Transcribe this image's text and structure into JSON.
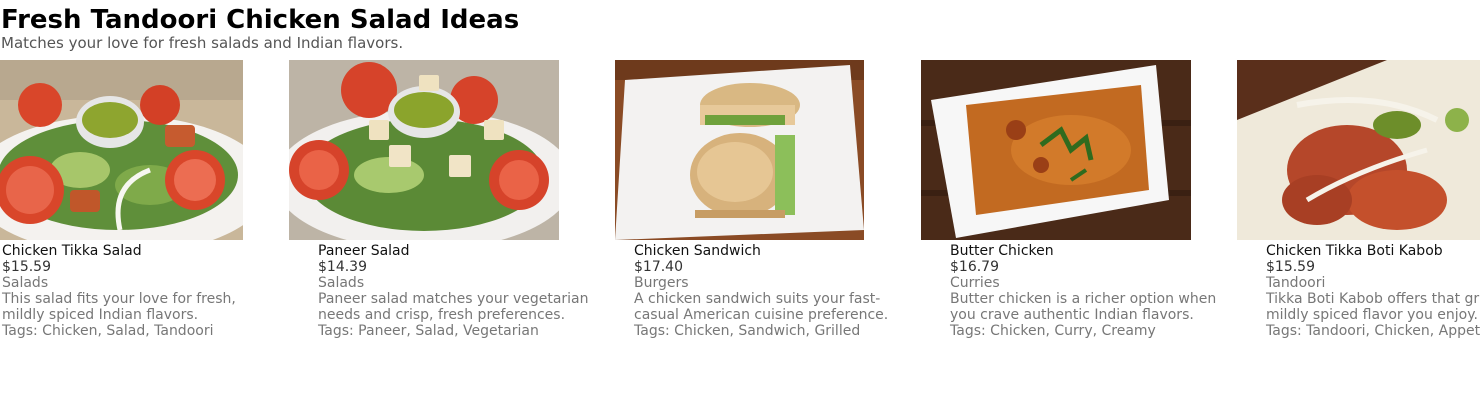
{
  "header": {
    "title": "Fresh Tandoori Chicken Salad Ideas",
    "subtitle": "Matches your love for fresh salads and Indian flavors."
  },
  "cards": [
    {
      "name": "Chicken Tikka Salad",
      "price": "$15.59",
      "category": "Salads",
      "description_line1": "This salad fits your love for fresh,",
      "description_line2": "mildly spiced Indian flavors.",
      "tags_label": "Tags:",
      "tags": "Chicken, Salad, Tandoori",
      "image_icon": "chicken-tikka-salad-photo"
    },
    {
      "name": "Paneer Salad",
      "price": "$14.39",
      "category": "Salads",
      "description_line1": "Paneer salad matches your vegetarian",
      "description_line2": "needs and crisp, fresh preferences.",
      "tags_label": "Tags:",
      "tags": "Paneer, Salad, Vegetarian",
      "image_icon": "paneer-salad-photo"
    },
    {
      "name": "Chicken Sandwich",
      "price": "$17.40",
      "category": "Burgers",
      "description_line1": "A chicken sandwich suits your fast-",
      "description_line2": "casual American cuisine preference.",
      "tags_label": "Tags:",
      "tags": "Chicken, Sandwich, Grilled",
      "image_icon": "chicken-sandwich-photo"
    },
    {
      "name": "Butter Chicken",
      "price": "$16.79",
      "category": "Curries",
      "description_line1": "Butter chicken is a richer option when",
      "description_line2": "you crave authentic Indian flavors.",
      "tags_label": "Tags:",
      "tags": "Chicken, Curry, Creamy",
      "image_icon": "butter-chicken-photo"
    },
    {
      "name": "Chicken Tikka Boti Kabob",
      "price": "$15.59",
      "category": "Tandoori",
      "description_line1": "Tikka Boti Kabob offers that gr",
      "description_line2": "mildly spiced flavor you enjoy.",
      "tags_label": "Tags:",
      "tags": "Tandoori, Chicken, Appet",
      "image_icon": "chicken-tikka-boti-kabob-photo"
    }
  ]
}
